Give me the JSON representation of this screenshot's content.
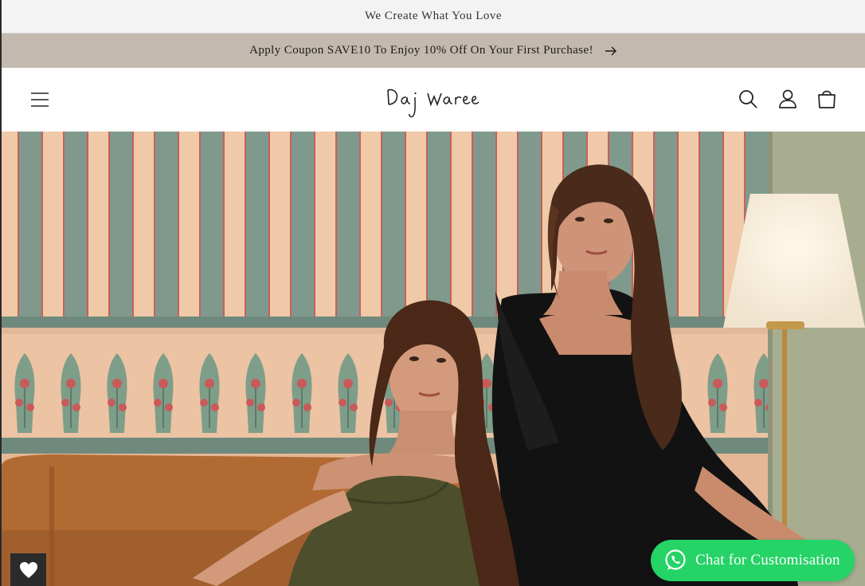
{
  "announcement": {
    "text": "We Create What You Love"
  },
  "promo": {
    "text": "Apply Coupon SAVE10 To Enjoy 10% Off On Your First Purchase!",
    "arrow_icon": "arrow-right-icon"
  },
  "header": {
    "logo_text": "Daj Waree",
    "icons": [
      "menu-icon",
      "search-icon",
      "account-icon",
      "cart-icon"
    ]
  },
  "hero": {
    "image": "two models in dark green and black outfits seated on sofa"
  },
  "floating": {
    "wishlist_icon": "heart-icon",
    "chat_label": "Chat for Customisation",
    "chat_icon": "whatsapp-icon"
  },
  "colors": {
    "promo_bg": "#c3b9ae",
    "topbar_bg": "#f3f3f3",
    "chat_bg": "#25d366",
    "wishlist_bg": "#2b2b2b"
  }
}
